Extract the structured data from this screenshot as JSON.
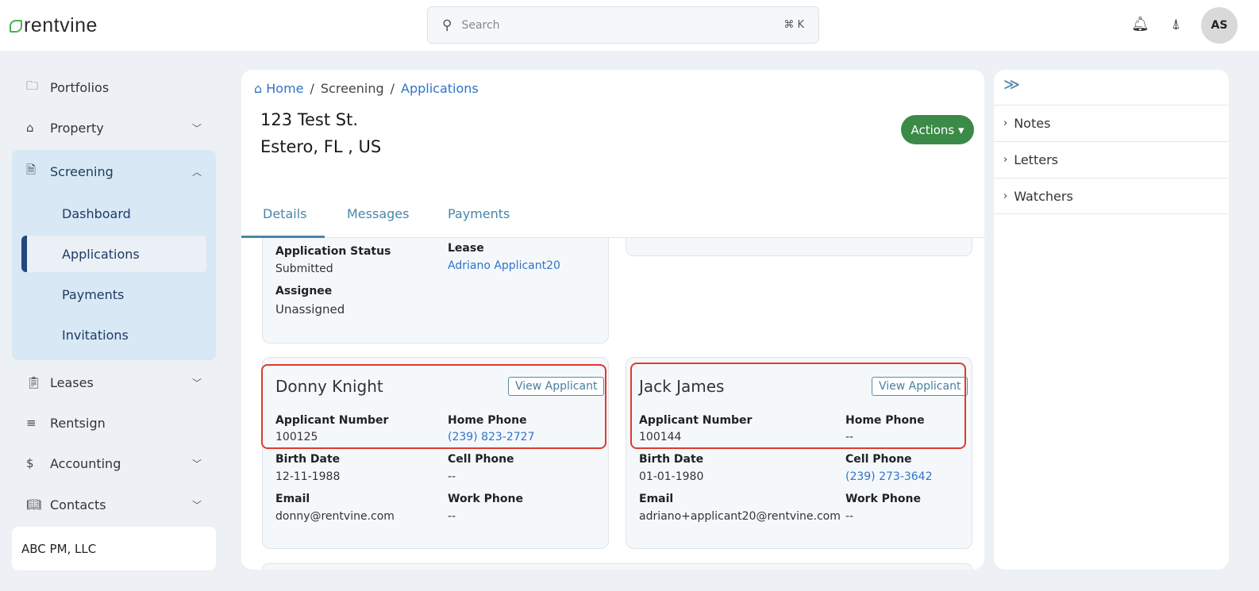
{
  "header": {
    "logo": "rentvine",
    "search_placeholder": "Search",
    "search_shortcut": "⌘ K",
    "avatar": "AS"
  },
  "sidebar": {
    "items": [
      {
        "label": "Portfolios",
        "icon": "folder-icon"
      },
      {
        "label": "Property",
        "icon": "building-icon",
        "chevron": "⌄"
      },
      {
        "label": "Screening",
        "icon": "screening-icon",
        "chevron": "⌃"
      },
      {
        "label": "Leases",
        "icon": "clipboard-icon",
        "chevron": "⌄"
      },
      {
        "label": "Rentsign",
        "icon": "sign-icon"
      },
      {
        "label": "Accounting",
        "icon": "dollar-icon",
        "chevron": "⌄"
      },
      {
        "label": "Contacts",
        "icon": "book-icon",
        "chevron": "⌄"
      }
    ],
    "screening_sub": [
      "Dashboard",
      "Applications",
      "Payments",
      "Invitations"
    ],
    "org": "ABC PM, LLC"
  },
  "breadcrumb": {
    "home": "Home",
    "sep": "/",
    "screening": "Screening",
    "applications": "Applications"
  },
  "address": {
    "line1": "123 Test St.",
    "line2": "Estero, FL , US"
  },
  "actions_label": "Actions ▾",
  "tabs": [
    "Details",
    "Messages",
    "Payments"
  ],
  "summary": {
    "status_label": "Application Status",
    "status": "Submitted",
    "lease_label": "Lease",
    "lease": "Adriano Applicant20",
    "assignee_label": "Assignee",
    "assignee": "Unassigned"
  },
  "applicants": [
    {
      "name": "Donny Knight",
      "view": "View Applicant",
      "num_label": "Applicant Number",
      "num": "100125",
      "home_label": "Home Phone",
      "home": "(239) 823-2727",
      "birth_label": "Birth Date",
      "birth": "12-11-1988",
      "cell_label": "Cell Phone",
      "cell": "--",
      "email_label": "Email",
      "email": "donny@rentvine.com",
      "work_label": "Work Phone",
      "work": "--"
    },
    {
      "name": "Jack James",
      "view": "View Applicant",
      "num_label": "Applicant Number",
      "num": "100144",
      "home_label": "Home Phone",
      "home": "--",
      "birth_label": "Birth Date",
      "birth": "01-01-1980",
      "cell_label": "Cell Phone",
      "cell": "(239) 273-3642",
      "email_label": "Email",
      "email": "adriano+applicant20@rentvine.com",
      "work_label": "Work Phone",
      "work": "--"
    }
  ],
  "right_panel": {
    "collapse": "≫",
    "items": [
      "Notes",
      "Letters",
      "Watchers"
    ]
  },
  "colors": {
    "accent": "#2f73c8",
    "action": "#3b8a47",
    "highlight": "#e03a2f"
  }
}
